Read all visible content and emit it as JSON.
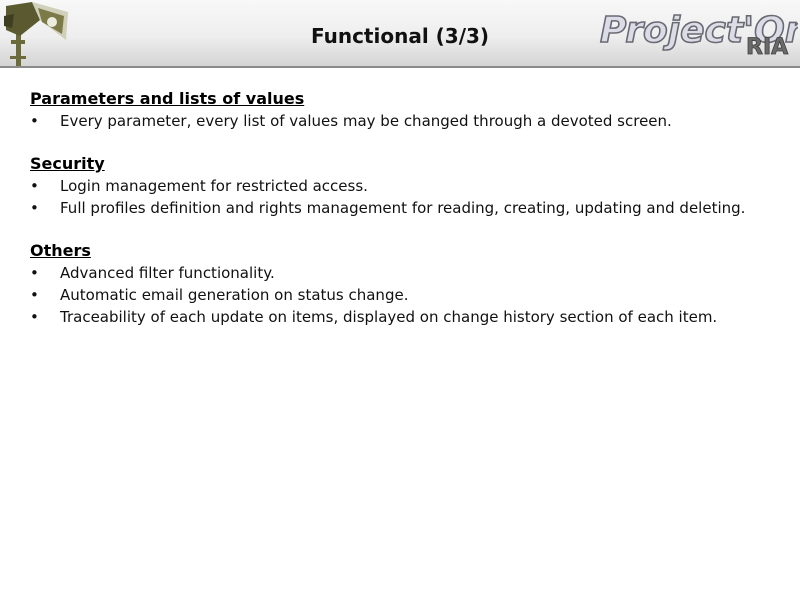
{
  "header": {
    "title": "Functional (3/3)",
    "logo_text": "Project'Or",
    "logo_subtext": "RIA"
  },
  "sections": [
    {
      "title": "Parameters and lists of values",
      "items": [
        "Every parameter, every list of values may be changed through a devoted screen."
      ]
    },
    {
      "title": "Security",
      "items": [
        "Login management for restricted access.",
        "Full profiles definition and rights management for reading, creating, updating and deleting."
      ]
    },
    {
      "title": "Others",
      "items": [
        "Advanced filter functionality.",
        "Automatic email generation on status change.",
        "Traceability of each update on items, displayed on change history section of each item."
      ]
    }
  ],
  "bullet_glyph": "•",
  "colors": {
    "logo_olive": "#6b6a3a",
    "logo_light": "#d8d8e4",
    "rule": "#8a8a8a"
  }
}
